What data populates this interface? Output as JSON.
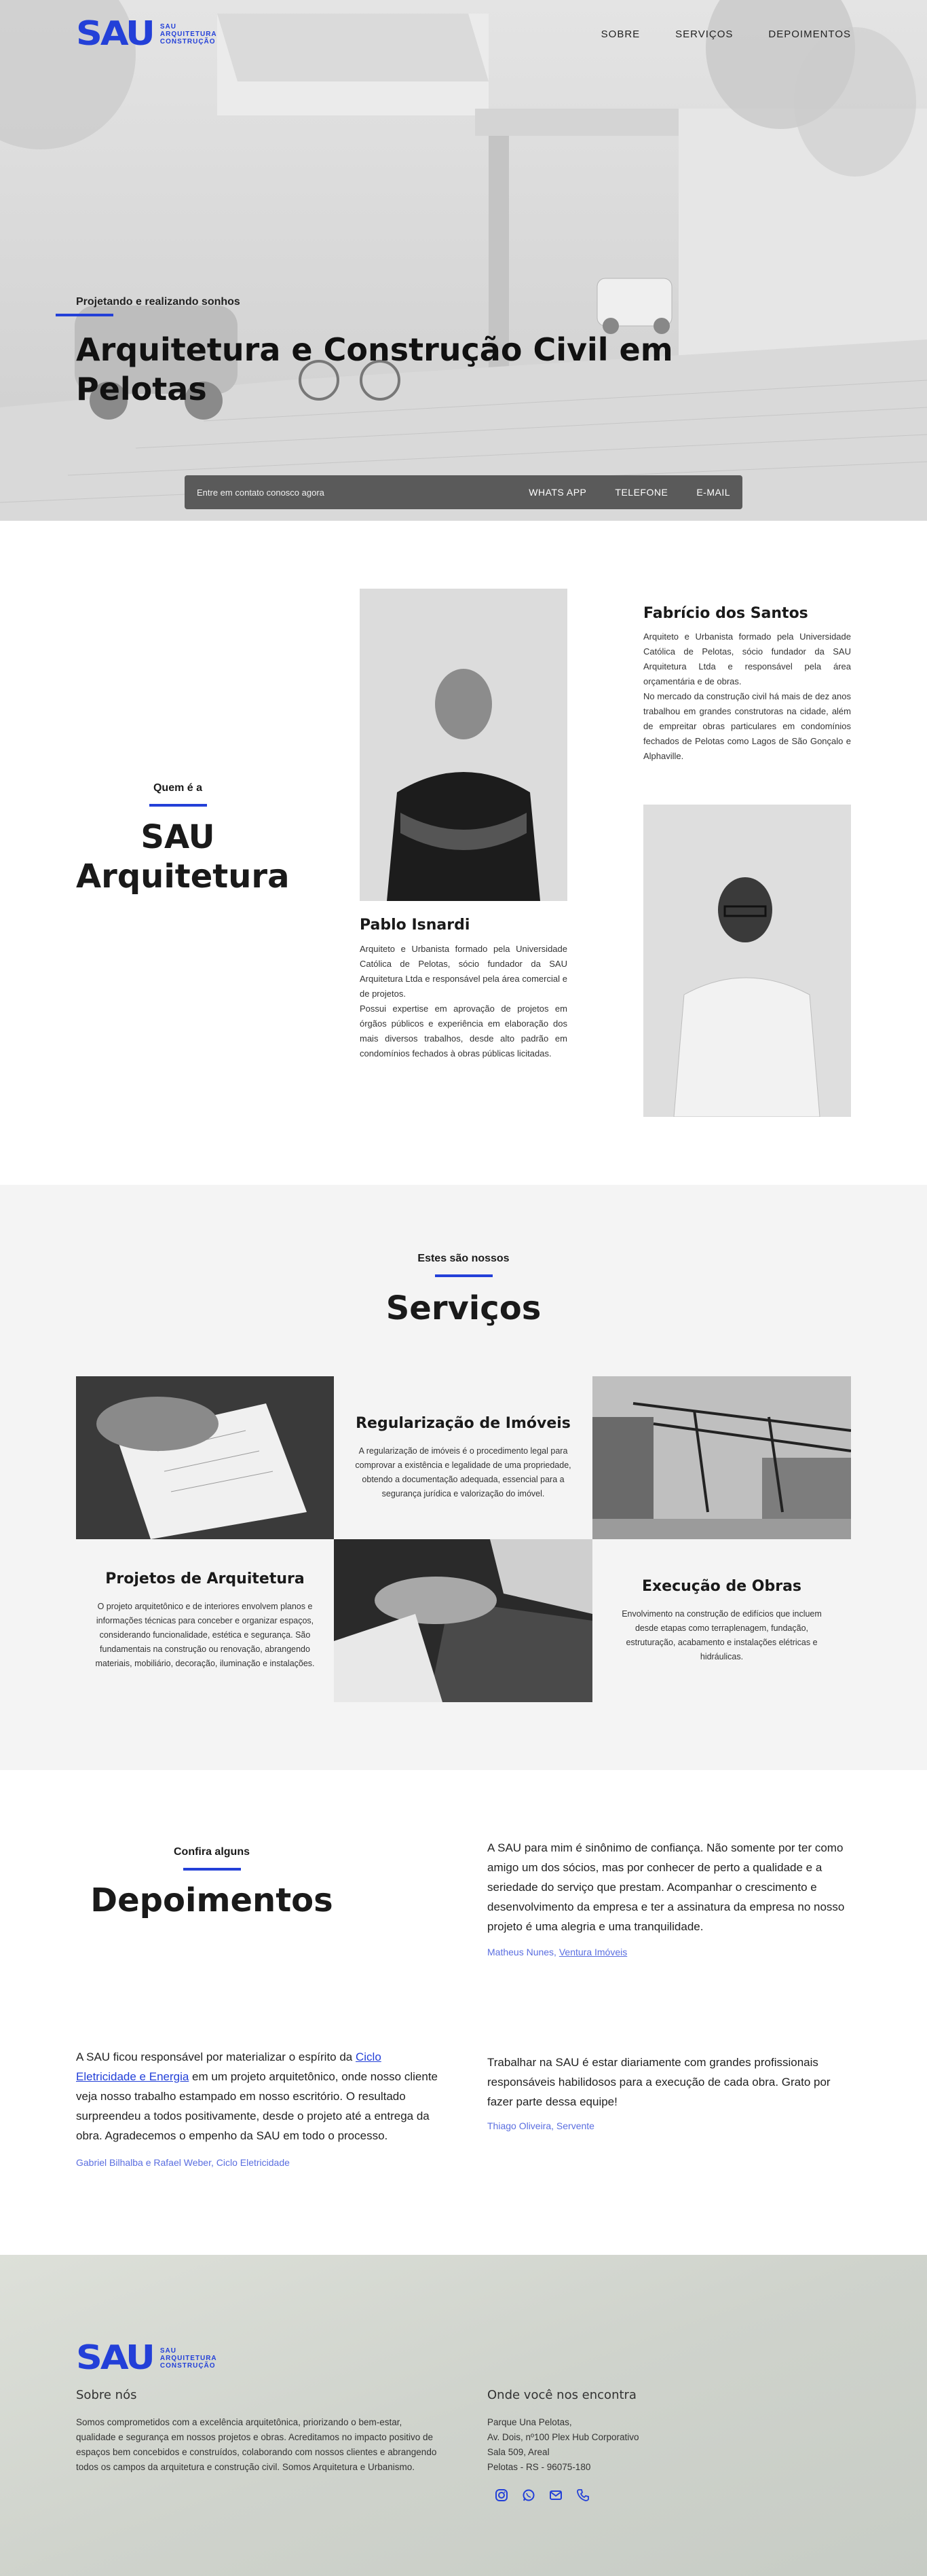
{
  "brand": {
    "mark": "SAU",
    "line1": "SAU",
    "line2": "ARQUITETURA",
    "line3": "CONSTRUÇÃO",
    "accent": "#2340d8"
  },
  "nav": {
    "items": [
      "SOBRE",
      "SERVIÇOS",
      "DEPOIMENTOS"
    ]
  },
  "hero": {
    "eyebrow": "Projetando e realizando sonhos",
    "title": "Arquitetura e Construção Civil em Pelotas",
    "contact_text": "Entre em contato conosco agora",
    "contact_links": [
      "WHATS APP",
      "TELEFONE",
      "E-MAIL"
    ]
  },
  "quem": {
    "eyebrow": "Quem é a",
    "title_line1": "SAU",
    "title_line2": "Arquitetura",
    "person1": {
      "name": "Pablo Isnardi",
      "bio": "Arquiteto e Urbanista formado pela Universidade Católica de Pelotas, sócio fundador da SAU Arquitetura Ltda e responsável pela área comercial e de projetos.",
      "bio2": "Possui expertise em aprovação de projetos em órgãos públicos e experiência em elaboração dos mais diversos trabalhos, desde alto padrão em condomínios fechados à obras públicas licitadas."
    },
    "person2": {
      "name": "Fabrício dos Santos",
      "bio": "Arquiteto e Urbanista formado pela Universidade Católica de Pelotas, sócio fundador da SAU Arquitetura Ltda e responsável pela área orçamentária e de obras.",
      "bio2": "No mercado da construção civil há mais de dez anos trabalhou em grandes construtoras na cidade, além de empreitar obras particulares em condomínios fechados de Pelotas como Lagos de São Gonçalo e Alphaville."
    }
  },
  "servicos": {
    "eyebrow": "Estes são nossos",
    "title": "Serviços",
    "items": [
      {
        "title": "Regularização de Imóveis",
        "text": "A regularização de imóveis é o procedimento legal para comprovar a existência e legalidade de uma propriedade, obtendo a documentação adequada, essencial para a segurança jurídica e valorização do imóvel."
      },
      {
        "title": "Projetos de Arquitetura",
        "text": "O projeto arquitetônico e de interiores envolvem planos e informações técnicas para conceber e organizar espaços, considerando funcionalidade, estética e segurança. São fundamentais na construção ou renovação, abrangendo materiais, mobiliário, decoração, iluminação e instalações."
      },
      {
        "title": "Execução de Obras",
        "text": "Envolvimento na construção de edifícios que incluem desde etapas como terraplenagem, fundação, estruturação, acabamento e instalações elétricas e hidráulicas."
      }
    ]
  },
  "depoimentos": {
    "eyebrow": "Confira alguns",
    "title": "Depoimentos",
    "q1": {
      "text": "A SAU para mim é sinônimo de confiança. Não somente por ter como amigo um dos sócios, mas por conhecer de perto a qualidade e a seriedade do serviço que prestam. Acompanhar o crescimento e desenvolvimento da empresa e ter a assinatura da empresa no nosso projeto é uma alegria e uma tranquilidade.",
      "author": "Matheus Nunes,",
      "author_link": "Ventura Imóveis"
    },
    "q2": {
      "text_before": "A SAU ficou responsável por materializar o espírito da ",
      "link": "Ciclo Eletricidade e Energia",
      "text_after": " em um projeto arquitetônico, onde nosso cliente veja nosso trabalho estampado em nosso escritório. O resultado surpreendeu a todos positivamente, desde o projeto até a entrega da obra. Agradecemos o empenho da SAU em todo o processo.",
      "author": "Gabriel Bilhalba e Rafael Weber, Ciclo Eletricidade"
    },
    "q3": {
      "text": "Trabalhar na SAU é estar diariamente com grandes profissionais responsáveis habilidosos para a execução de cada obra. Grato por fazer parte dessa equipe!",
      "author": "Thiago Oliveira, Servente"
    }
  },
  "footer": {
    "about_title": "Sobre nós",
    "about_text": "Somos comprometidos com a excelência arquitetônica, priorizando o bem-estar, qualidade e segurança em nossos projetos e obras. Acreditamos no impacto positivo de espaços bem concebidos e construídos, colaborando com nossos clientes e abrangendo todos os campos da arquitetura e construção civil. Somos Arquitetura e Urbanismo.",
    "where_title": "Onde você nos encontra",
    "address": [
      "Parque Una Pelotas,",
      "Av. Dois, nº100 Plex Hub Corporativo",
      "Sala 509, Areal",
      "Pelotas - RS - 96075-180"
    ],
    "icons": [
      "instagram-icon",
      "whatsapp-icon",
      "email-icon",
      "phone-icon"
    ]
  }
}
